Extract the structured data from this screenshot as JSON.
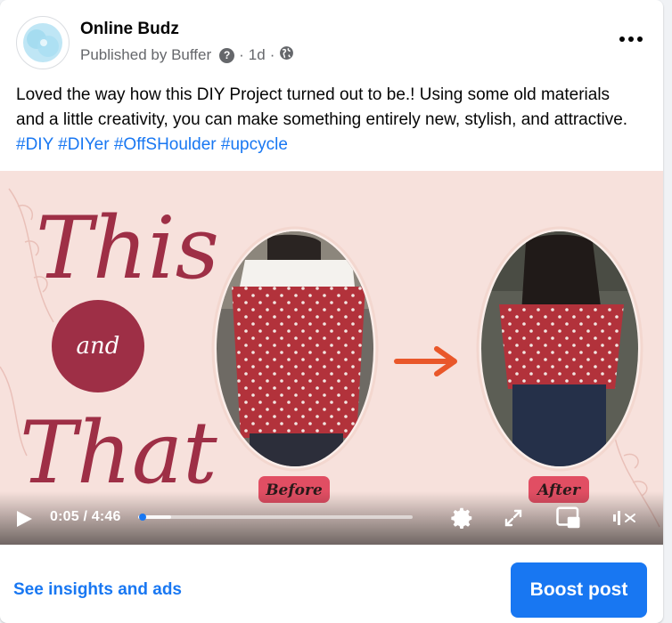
{
  "post": {
    "author": "Online Budz",
    "published_by": "Published by Buffer",
    "help_glyph": "?",
    "separator": "·",
    "time": "1d",
    "audience_icon": "globe-icon",
    "more_icon": "more-horizontal-icon",
    "text": "Loved the way how this DIY Project turned out to be.! Using some old materials and a little creativity, you can make something entirely new, stylish, and attractive.",
    "hashtags": "#DIY #DIYer #OffSHoulder #upcycle"
  },
  "video": {
    "title_top": "This",
    "title_and": "and",
    "title_bottom": "That",
    "label_before": "Before",
    "label_after": "After",
    "current_time": "0:05",
    "duration": "4:46",
    "time_display": "0:05 / 4:46",
    "progress_fraction": 0.017,
    "buffered_fraction": 0.12,
    "muted": true
  },
  "footer": {
    "insights_label": "See insights and ads",
    "boost_label": "Boost post"
  },
  "colors": {
    "accent": "#1877f2",
    "text": "#050505",
    "secondary_text": "#65676b",
    "video_bg": "#f7e1dc",
    "maroon": "#9e2f46",
    "arrow": "#e9572a"
  }
}
